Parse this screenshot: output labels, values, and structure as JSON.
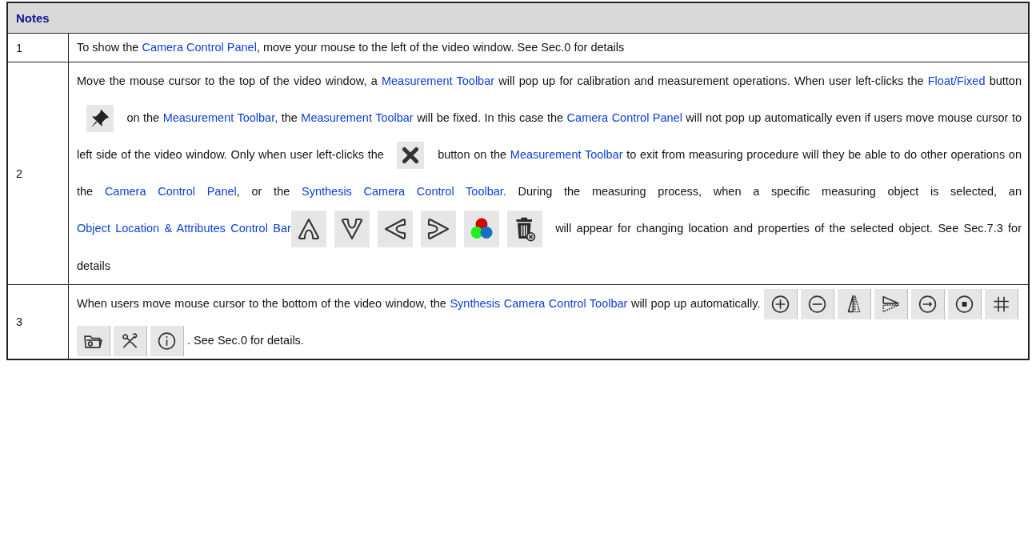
{
  "table": {
    "header": "Notes",
    "rows": [
      {
        "number": "1",
        "segments": [
          {
            "kind": "text",
            "text": "To show the "
          },
          {
            "kind": "term",
            "text": "Camera Control Panel"
          },
          {
            "kind": "text",
            "text": ", move your mouse to the left of the video window. See Sec.0 for details"
          }
        ]
      },
      {
        "number": "2",
        "segments": [
          {
            "kind": "text",
            "text": "Move the mouse cursor to the top of  the video window, a "
          },
          {
            "kind": "term",
            "text": "Measurement Toolbar"
          },
          {
            "kind": "text",
            "text": " will pop up for calibration and measurement operations. When user left-clicks the "
          },
          {
            "kind": "term",
            "text": "Float/Fixed"
          },
          {
            "kind": "text",
            "text": " button "
          },
          {
            "kind": "pin"
          },
          {
            "kind": "text",
            "text": " on the "
          },
          {
            "kind": "term",
            "text": "Measurement Toolbar,"
          },
          {
            "kind": "text",
            "text": " the "
          },
          {
            "kind": "term",
            "text": "Measurement Toolbar"
          },
          {
            "kind": "text",
            "text": " will be fixed. In this case the "
          },
          {
            "kind": "term",
            "text": "Camera Control Panel"
          },
          {
            "kind": "text",
            "text": " will not pop up automatically even if users move mouse cursor to left side of the video window. Only when user left-clicks the "
          },
          {
            "kind": "cross"
          },
          {
            "kind": "text",
            "text": " button on the "
          },
          {
            "kind": "term",
            "text": "Measurement Toolbar"
          },
          {
            "kind": "text",
            "text": " to exit from measuring procedure will they be able to do other operations on the "
          },
          {
            "kind": "term",
            "text": "Camera Control Panel"
          },
          {
            "kind": "text",
            "text": ", or the "
          },
          {
            "kind": "term",
            "text": "Synthesis Camera Control Toolbar."
          },
          {
            "kind": "text",
            "text": " During the measuring process, when a specific measuring object is selected, an "
          },
          {
            "kind": "term",
            "text": "Object Location & Attributes Control Bar"
          },
          {
            "kind": "up"
          },
          {
            "kind": "down"
          },
          {
            "kind": "left"
          },
          {
            "kind": "right"
          },
          {
            "kind": "color"
          },
          {
            "kind": "trash"
          },
          {
            "kind": "text",
            "text": " will appear for changing location and properties of the selected object. See Sec.7.3 for details"
          }
        ]
      },
      {
        "number": "3",
        "segments": [
          {
            "kind": "text",
            "text": "When users move mouse cursor to the bottom of the video window, the "
          },
          {
            "kind": "term",
            "text": "Synthesis Camera Control Toolbar"
          },
          {
            "kind": "text",
            "text": " will pop up automatically. "
          },
          {
            "kind": "zoom-in"
          },
          {
            "kind": "zoom-out"
          },
          {
            "kind": "flip-h"
          },
          {
            "kind": "flip-v"
          },
          {
            "kind": "cg"
          },
          {
            "kind": "record"
          },
          {
            "kind": "grid"
          },
          {
            "kind": "folder"
          },
          {
            "kind": "tools"
          },
          {
            "kind": "info"
          },
          {
            "kind": "text",
            "text": ". See Sec.0 for details."
          }
        ]
      }
    ]
  }
}
